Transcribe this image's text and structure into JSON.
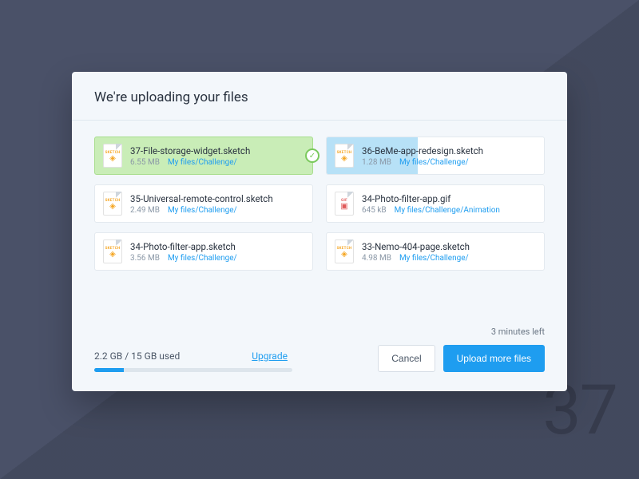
{
  "bg_number": "37",
  "header": {
    "title": "We're uploading your files"
  },
  "files": [
    {
      "name": "37-File-storage-widget.sketch",
      "size": "6.55 MB",
      "path": "My files/Challenge/",
      "type": "sketch",
      "state": "done",
      "progress": 100
    },
    {
      "name": "36-BeMe-app-redesign.sketch",
      "size": "1.28 MB",
      "path": "My files/Challenge/",
      "type": "sketch",
      "state": "progress",
      "progress": 42
    },
    {
      "name": "35-Universal-remote-control.sketch",
      "size": "2.49 MB",
      "path": "My files/Challenge/",
      "type": "sketch",
      "state": "pending",
      "progress": 0
    },
    {
      "name": "34-Photo-filter-app.gif",
      "size": "645 kB",
      "path": "My files/Challenge/Animation",
      "type": "gif",
      "state": "pending",
      "progress": 0
    },
    {
      "name": "34-Photo-filter-app.sketch",
      "size": "3.56 MB",
      "path": "My files/Challenge/",
      "type": "sketch",
      "state": "pending",
      "progress": 0
    },
    {
      "name": "33-Nemo-404-page.sketch",
      "size": "4.98 MB",
      "path": "My files/Challenge/",
      "type": "sketch",
      "state": "pending",
      "progress": 0
    }
  ],
  "time_left": "3 minutes left",
  "storage": {
    "used_text": "2.2 GB / 15 GB used",
    "upgrade_label": "Upgrade",
    "percent": 15
  },
  "actions": {
    "cancel": "Cancel",
    "upload_more": "Upload more files"
  },
  "icon_labels": {
    "sketch": "SKETCH",
    "gif": "GIF"
  }
}
